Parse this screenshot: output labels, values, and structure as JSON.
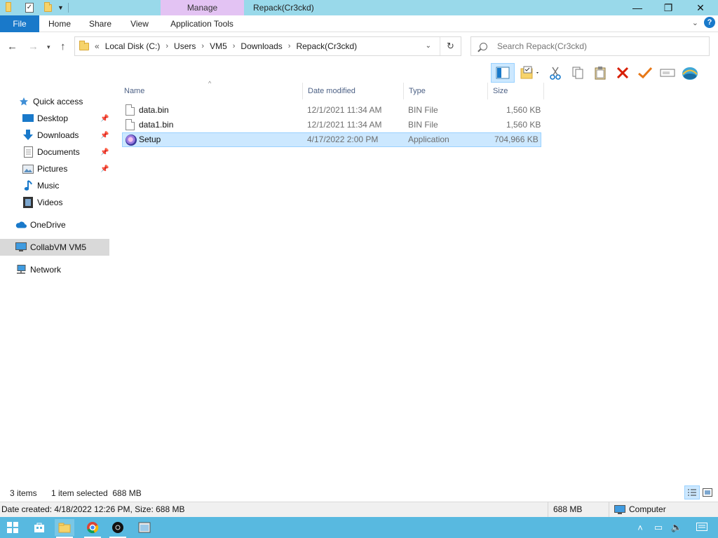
{
  "window": {
    "title": "Repack(Cr3ckd)",
    "context_tab": "Manage",
    "minimize": "—",
    "maximize": "❐",
    "close": "✕"
  },
  "ribbon": {
    "tabs": [
      "File",
      "Home",
      "Share",
      "View",
      "Application Tools"
    ]
  },
  "address": {
    "overflow": "«",
    "crumbs": [
      "Local Disk (C:)",
      "Users",
      "VM5",
      "Downloads",
      "Repack(Cr3ckd)"
    ],
    "separator": "›"
  },
  "search": {
    "placeholder": "Search Repack(Cr3ckd)"
  },
  "sidebar": {
    "items": [
      {
        "label": "Quick access",
        "icon": "star-icon"
      },
      {
        "label": "Desktop",
        "icon": "desktop-icon",
        "pinned": true
      },
      {
        "label": "Downloads",
        "icon": "download-arrow-icon",
        "pinned": true
      },
      {
        "label": "Documents",
        "icon": "documents-icon",
        "pinned": true
      },
      {
        "label": "Pictures",
        "icon": "pictures-icon",
        "pinned": true
      },
      {
        "label": "Music",
        "icon": "music-note-icon"
      },
      {
        "label": "Videos",
        "icon": "film-icon"
      },
      {
        "label": "OneDrive",
        "icon": "cloud-icon"
      },
      {
        "label": "CollabVM VM5",
        "icon": "computer-icon",
        "selected": true
      },
      {
        "label": "Network",
        "icon": "network-icon"
      }
    ]
  },
  "columns": {
    "name": "Name",
    "date": "Date modified",
    "type": "Type",
    "size": "Size"
  },
  "files": [
    {
      "name": "data.bin",
      "date": "12/1/2021 11:34 AM",
      "type": "BIN File",
      "size": "1,560 KB",
      "icon": "file-icon"
    },
    {
      "name": "data1.bin",
      "date": "12/1/2021 11:34 AM",
      "type": "BIN File",
      "size": "1,560 KB",
      "icon": "file-icon"
    },
    {
      "name": "Setup",
      "date": "4/17/2022 2:00 PM",
      "type": "Application",
      "size": "704,966 KB",
      "icon": "setup-app-icon",
      "selected": true
    }
  ],
  "status": {
    "item_count": "3 items",
    "selection": "1 item selected  688 MB",
    "details": "Date created: 4/18/2022 12:26 PM, Size: 688 MB",
    "size": "688 MB",
    "location": "Computer"
  },
  "colors": {
    "titlebar": "#99d9ea",
    "manage_tab": "#e3c3f3",
    "file_tab": "#1979ca",
    "selection": "#cce8ff",
    "taskbar": "#58b9e0"
  }
}
